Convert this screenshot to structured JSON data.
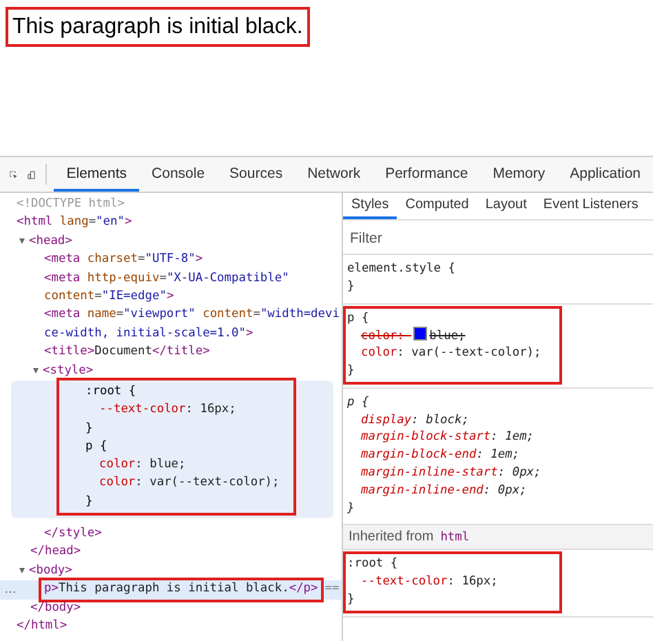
{
  "page": {
    "paragraph": "This paragraph is initial black.",
    "annotated": true
  },
  "devtools": {
    "tabs": [
      {
        "label": "Elements",
        "selected": true
      },
      {
        "label": "Console",
        "selected": false
      },
      {
        "label": "Sources",
        "selected": false
      },
      {
        "label": "Network",
        "selected": false
      },
      {
        "label": "Performance",
        "selected": false
      },
      {
        "label": "Memory",
        "selected": false
      },
      {
        "label": "Application",
        "selected": false
      }
    ],
    "dom_tree": [
      {
        "lines": [
          [
            {
              "kind": "comment",
              "text": "<!DOCTYPE html>"
            }
          ]
        ]
      },
      {
        "lines": [
          [
            {
              "kind": "tag",
              "text": "<html"
            },
            {
              "kind": "attr",
              "text": " lang"
            },
            {
              "kind": "punct",
              "text": "="
            },
            {
              "kind": "value",
              "text": "\"en\""
            },
            {
              "kind": "tag",
              "text": ">"
            }
          ]
        ],
        "closing": [
          {
            "kind": "tag",
            "text": "</html>"
          }
        ],
        "children": [
          {
            "expanded": true,
            "lines": [
              [
                {
                  "kind": "tag",
                  "text": "<head>"
                }
              ]
            ],
            "closing": [
              {
                "kind": "tag",
                "text": "</head>"
              }
            ],
            "children": [
              {
                "lines": [
                  [
                    {
                      "kind": "tag",
                      "text": "<meta"
                    },
                    {
                      "kind": "attr",
                      "text": " charset"
                    },
                    {
                      "kind": "punct",
                      "text": "="
                    },
                    {
                      "kind": "value",
                      "text": "\"UTF-8\""
                    },
                    {
                      "kind": "tag",
                      "text": ">"
                    }
                  ]
                ]
              },
              {
                "lines": [
                  [
                    {
                      "kind": "tag",
                      "text": "<meta"
                    },
                    {
                      "kind": "attr",
                      "text": " http-equiv"
                    },
                    {
                      "kind": "punct",
                      "text": "="
                    },
                    {
                      "kind": "value",
                      "text": "\"X-UA-Compatible\""
                    }
                  ],
                  [
                    {
                      "kind": "attr",
                      "text": "content"
                    },
                    {
                      "kind": "punct",
                      "text": "="
                    },
                    {
                      "kind": "value",
                      "text": "\"IE=edge\""
                    },
                    {
                      "kind": "tag",
                      "text": ">"
                    }
                  ]
                ]
              },
              {
                "lines": [
                  [
                    {
                      "kind": "tag",
                      "text": "<meta"
                    },
                    {
                      "kind": "attr",
                      "text": " name"
                    },
                    {
                      "kind": "punct",
                      "text": "="
                    },
                    {
                      "kind": "value",
                      "text": "\"viewport\""
                    },
                    {
                      "kind": "attr",
                      "text": " content"
                    },
                    {
                      "kind": "punct",
                      "text": "="
                    },
                    {
                      "kind": "value",
                      "text": "\"width=devi"
                    }
                  ],
                  [
                    {
                      "kind": "value",
                      "text": "ce-width, initial-scale=1.0\""
                    },
                    {
                      "kind": "tag",
                      "text": ">"
                    }
                  ]
                ]
              },
              {
                "lines": [
                  [
                    {
                      "kind": "tag",
                      "text": "<title>"
                    },
                    {
                      "kind": "text",
                      "text": "Document"
                    },
                    {
                      "kind": "tag",
                      "text": "</title>"
                    }
                  ]
                ]
              },
              {
                "expanded": true,
                "lines": [
                  [
                    {
                      "kind": "tag",
                      "text": "<style>"
                    }
                  ]
                ],
                "closing": [
                  {
                    "kind": "tag",
                    "text": "</style>"
                  }
                ],
                "stylesheet": {
                  "annotated": true,
                  "rules": [
                    {
                      "selector": ":root {",
                      "declarations": [
                        {
                          "prop": "--text-color",
                          "value": ": 16px;"
                        }
                      ],
                      "close": "}"
                    },
                    {
                      "selector": "p {",
                      "declarations": [
                        {
                          "prop": "color",
                          "value": ": blue;"
                        },
                        {
                          "prop": "color",
                          "value": ": var(--text-color);"
                        }
                      ],
                      "close": "}"
                    }
                  ]
                }
              }
            ]
          },
          {
            "expanded": true,
            "lines": [
              [
                {
                  "kind": "tag",
                  "text": "<body>"
                }
              ]
            ],
            "closing": [
              {
                "kind": "tag",
                "text": "</body>"
              }
            ],
            "children": [
              {
                "selected": true,
                "annotated": true,
                "marker": "…",
                "trail": "==",
                "lines": [
                  [
                    {
                      "kind": "tag",
                      "text": "p>"
                    },
                    {
                      "kind": "text",
                      "text": "This paragraph is initial black."
                    },
                    {
                      "kind": "tag",
                      "text": "</p>"
                    }
                  ]
                ]
              }
            ]
          }
        ]
      }
    ],
    "styles_tabs": [
      {
        "label": "Styles",
        "selected": true
      },
      {
        "label": "Computed",
        "selected": false
      },
      {
        "label": "Layout",
        "selected": false
      },
      {
        "label": "Event Listeners",
        "selected": false
      }
    ],
    "filter": {
      "placeholder": "Filter"
    },
    "sections": [
      {
        "kind": "rule",
        "annotated": false,
        "selector": "element.style {",
        "close": "}"
      },
      {
        "kind": "rule",
        "annotated": true,
        "selector": "p {",
        "declarations": [
          {
            "prop": "color",
            "value": ": blue;",
            "struck": true,
            "color": "#0000ff"
          },
          {
            "prop": "color",
            "value": ": var(--text-color);",
            "struck": false
          }
        ],
        "close": "}"
      },
      {
        "kind": "ua-rule",
        "annotated": false,
        "selector": "p {",
        "declarations": [
          {
            "prop": "display",
            "value": ": block;",
            "struck": false
          },
          {
            "prop": "margin-block-start",
            "value": ": 1em;",
            "struck": false
          },
          {
            "prop": "margin-block-end",
            "value": ": 1em;",
            "struck": false
          },
          {
            "prop": "margin-inline-start",
            "value": ": 0px;",
            "struck": false
          },
          {
            "prop": "margin-inline-end",
            "value": ": 0px;",
            "struck": false
          }
        ],
        "close": "}"
      },
      {
        "kind": "inherited",
        "label": "Inherited from",
        "source": "html"
      },
      {
        "kind": "rule",
        "annotated": true,
        "selector": ":root {",
        "declarations": [
          {
            "prop": "--text-color",
            "value": ": 16px;",
            "struck": false
          }
        ],
        "close": "}"
      }
    ]
  }
}
